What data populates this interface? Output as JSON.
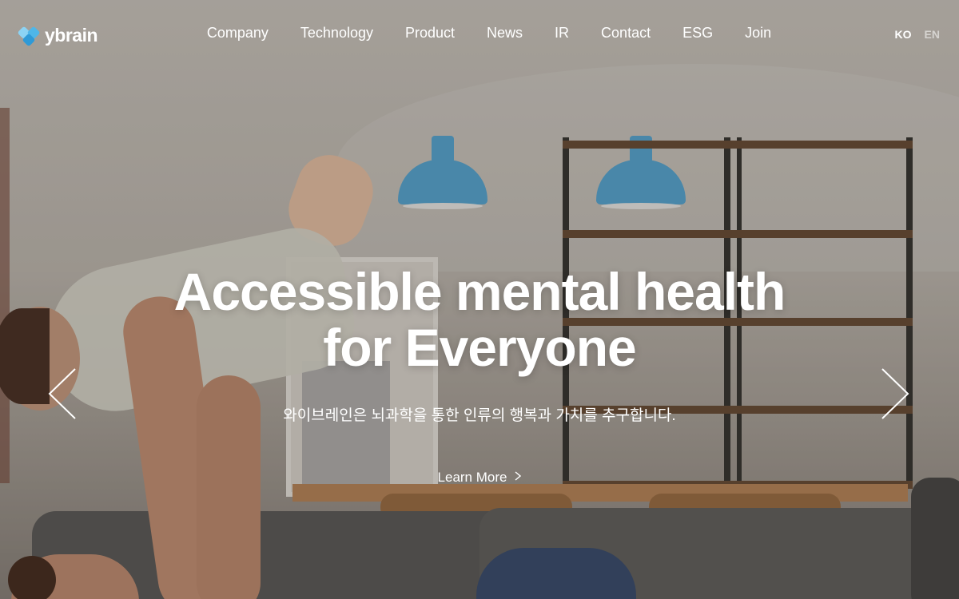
{
  "brand": {
    "name": "ybrain",
    "logo_icon": "ybrain-logo-icon"
  },
  "nav": {
    "items": [
      {
        "label": "Company"
      },
      {
        "label": "Technology"
      },
      {
        "label": "Product"
      },
      {
        "label": "News"
      },
      {
        "label": "IR"
      },
      {
        "label": "Contact"
      },
      {
        "label": "ESG"
      },
      {
        "label": "Join"
      }
    ]
  },
  "lang": {
    "ko": "KO",
    "en": "EN",
    "selected": "KO"
  },
  "hero": {
    "title_line1": "Accessible mental health",
    "title_line2": "for Everyone",
    "subtitle": "와이브레인은 뇌과학을 통한 인류의 행복과 가치를 추구합니다.",
    "cta_label": "Learn More",
    "cta_icon": "chevron-right-icon",
    "prev_icon": "chevron-left-icon",
    "next_icon": "chevron-right-icon"
  },
  "colors": {
    "accent": "#4fb6e8",
    "text": "#ffffff"
  }
}
